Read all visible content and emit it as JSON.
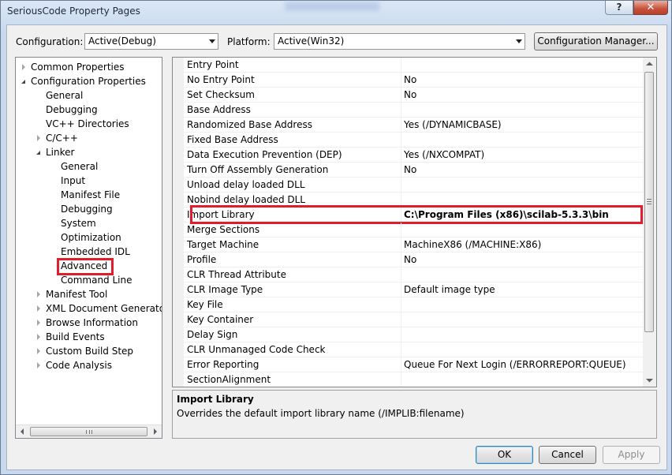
{
  "window": {
    "title": "SeriousCode Property Pages",
    "help_label": "?",
    "close_label": "✕"
  },
  "toolbar": {
    "configuration_label": "Configuration:",
    "configuration_value": "Active(Debug)",
    "platform_label": "Platform:",
    "platform_value": "Active(Win32)",
    "config_manager_label": "Configuration Manager..."
  },
  "tree": {
    "items": [
      {
        "label": "Common Properties",
        "level": 0,
        "state": "collapsed"
      },
      {
        "label": "Configuration Properties",
        "level": 0,
        "state": "expanded"
      },
      {
        "label": "General",
        "level": 1,
        "state": "leaf"
      },
      {
        "label": "Debugging",
        "level": 1,
        "state": "leaf"
      },
      {
        "label": "VC++ Directories",
        "level": 1,
        "state": "leaf"
      },
      {
        "label": "C/C++",
        "level": 1,
        "state": "collapsed"
      },
      {
        "label": "Linker",
        "level": 1,
        "state": "expanded"
      },
      {
        "label": "General",
        "level": 2,
        "state": "leaf"
      },
      {
        "label": "Input",
        "level": 2,
        "state": "leaf"
      },
      {
        "label": "Manifest File",
        "level": 2,
        "state": "leaf"
      },
      {
        "label": "Debugging",
        "level": 2,
        "state": "leaf"
      },
      {
        "label": "System",
        "level": 2,
        "state": "leaf"
      },
      {
        "label": "Optimization",
        "level": 2,
        "state": "leaf"
      },
      {
        "label": "Embedded IDL",
        "level": 2,
        "state": "leaf"
      },
      {
        "label": "Advanced",
        "level": 2,
        "state": "leaf",
        "selected": true
      },
      {
        "label": "Command Line",
        "level": 2,
        "state": "leaf"
      },
      {
        "label": "Manifest Tool",
        "level": 1,
        "state": "collapsed"
      },
      {
        "label": "XML Document Generator",
        "level": 1,
        "state": "collapsed"
      },
      {
        "label": "Browse Information",
        "level": 1,
        "state": "collapsed"
      },
      {
        "label": "Build Events",
        "level": 1,
        "state": "collapsed"
      },
      {
        "label": "Custom Build Step",
        "level": 1,
        "state": "collapsed"
      },
      {
        "label": "Code Analysis",
        "level": 1,
        "state": "collapsed"
      }
    ]
  },
  "grid": {
    "rows": [
      {
        "name": "Entry Point",
        "value": ""
      },
      {
        "name": "No Entry Point",
        "value": "No"
      },
      {
        "name": "Set Checksum",
        "value": "No"
      },
      {
        "name": "Base Address",
        "value": ""
      },
      {
        "name": "Randomized Base Address",
        "value": "Yes (/DYNAMICBASE)"
      },
      {
        "name": "Fixed Base Address",
        "value": ""
      },
      {
        "name": "Data Execution Prevention (DEP)",
        "value": "Yes (/NXCOMPAT)"
      },
      {
        "name": "Turn Off Assembly Generation",
        "value": "No"
      },
      {
        "name": "Unload delay loaded DLL",
        "value": ""
      },
      {
        "name": "Nobind delay loaded DLL",
        "value": ""
      },
      {
        "name": "Import Library",
        "value": "C:\\Program Files (x86)\\scilab-5.3.3\\bin",
        "highlighted": true
      },
      {
        "name": "Merge Sections",
        "value": ""
      },
      {
        "name": "Target Machine",
        "value": "MachineX86 (/MACHINE:X86)"
      },
      {
        "name": "Profile",
        "value": "No"
      },
      {
        "name": "CLR Thread Attribute",
        "value": ""
      },
      {
        "name": "CLR Image Type",
        "value": "Default image type"
      },
      {
        "name": "Key File",
        "value": ""
      },
      {
        "name": "Key Container",
        "value": ""
      },
      {
        "name": "Delay Sign",
        "value": ""
      },
      {
        "name": "CLR Unmanaged Code Check",
        "value": ""
      },
      {
        "name": "Error Reporting",
        "value": "Queue For Next Login (/ERRORREPORT:QUEUE)"
      },
      {
        "name": "SectionAlignment",
        "value": ""
      }
    ]
  },
  "description": {
    "title": "Import Library",
    "text": "Overrides the default import library name (/IMPLIB:filename)"
  },
  "buttons": {
    "ok": "OK",
    "cancel": "Cancel",
    "apply": "Apply"
  },
  "colors": {
    "highlight": "#e31c2c"
  }
}
